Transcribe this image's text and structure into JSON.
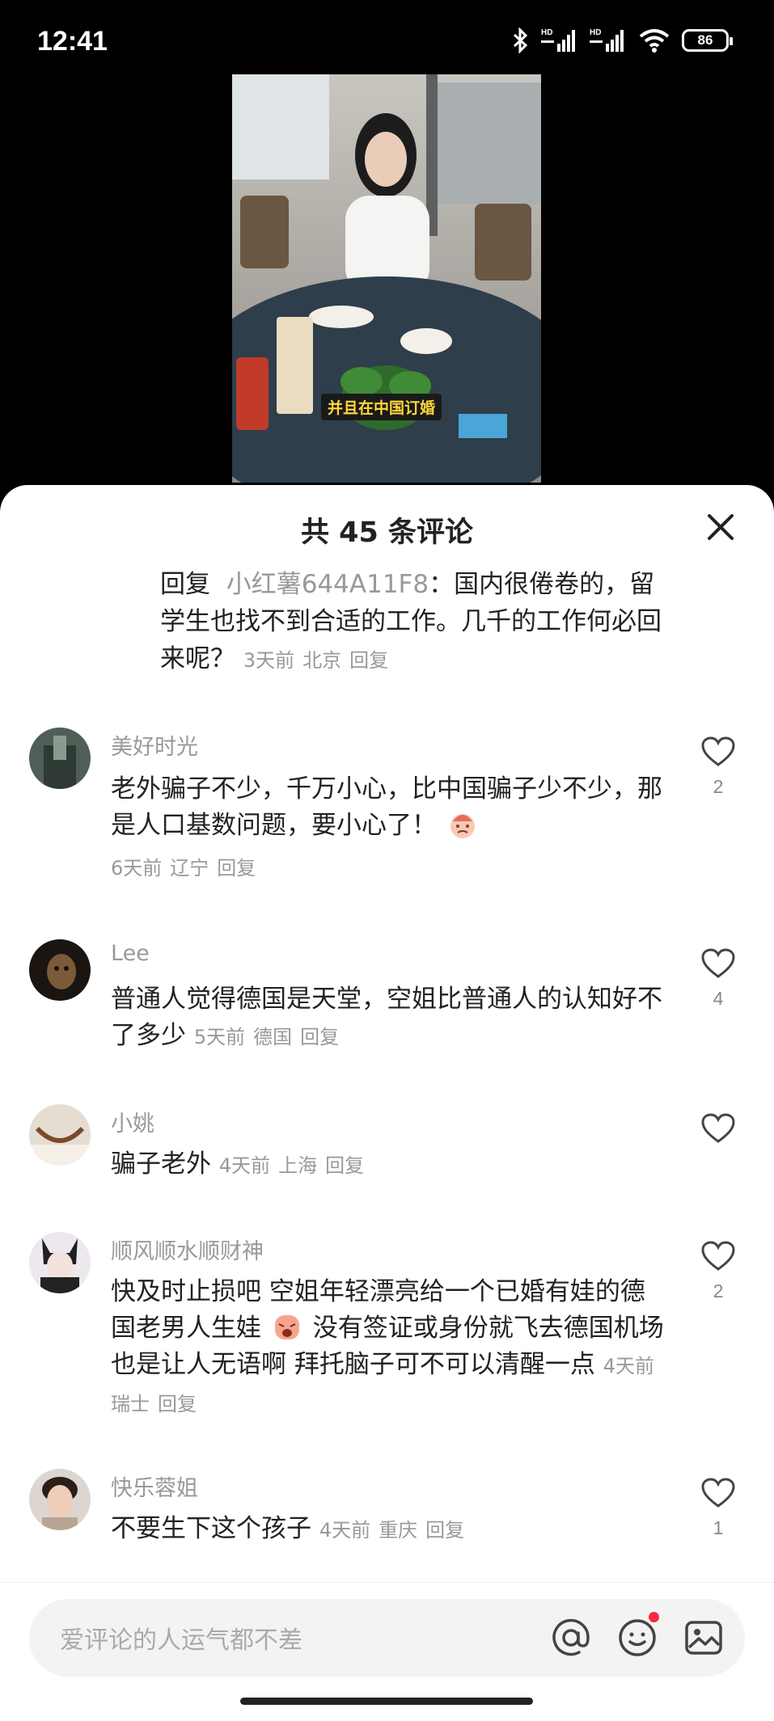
{
  "status_bar": {
    "time": "12:41",
    "signal_label_1": "HD",
    "signal_label_2": "HD",
    "battery": "86",
    "icons": [
      "bluetooth-icon",
      "signal-icon",
      "signal-icon",
      "wifi-icon",
      "battery-icon"
    ]
  },
  "video": {
    "caption": "并且在中国订婚"
  },
  "sheet": {
    "title": "共 45 条评论",
    "close_icon": "close-icon"
  },
  "reply": {
    "prefix": "回复",
    "target": "小红薯644A11F8",
    "text": "：国内很倦卷的，留学生也找不到合适的工作。几千的工作何必回来呢？",
    "time": "3天前",
    "location": "北京",
    "reply_label": "回复"
  },
  "comments": [
    {
      "user": "美好时光",
      "text": "老外骗子不少，千万小心，比中国骗子少不少，那是人口基数问题，要小心了！",
      "emoji": "face-emoji",
      "time": "6天前",
      "location": "辽宁",
      "reply_label": "回复",
      "likes": "2"
    },
    {
      "user": "Lee",
      "text": "普通人觉得德国是天堂，空姐比普通人的认知好不了多少",
      "time": "5天前",
      "location": "德国",
      "reply_label": "回复",
      "likes": "4"
    },
    {
      "user": "小姚",
      "text": "骗子老外",
      "time": "4天前",
      "location": "上海",
      "reply_label": "回复",
      "likes": ""
    },
    {
      "user": "顺风顺水顺财神",
      "text_a": "快及时止损吧 空姐年轻漂亮给一个已婚有娃的德国老男人生娃",
      "text_b": "没有签证或身份就飞去德国机场也是让人无语啊 拜托脑子可不可以清醒一点",
      "emoji": "crying-face-emoji",
      "time": "4天前",
      "location": "瑞士",
      "reply_label": "回复",
      "likes": "2"
    },
    {
      "user": "快乐蓉姐",
      "text": "不要生下这个孩子",
      "time": "4天前",
      "location": "重庆",
      "reply_label": "回复",
      "likes": "1"
    }
  ],
  "input_bar": {
    "placeholder": "爱评论的人运气都不差",
    "icons": [
      "at-icon",
      "emoji-icon",
      "image-icon"
    ],
    "accent_color": "#ff2442"
  }
}
